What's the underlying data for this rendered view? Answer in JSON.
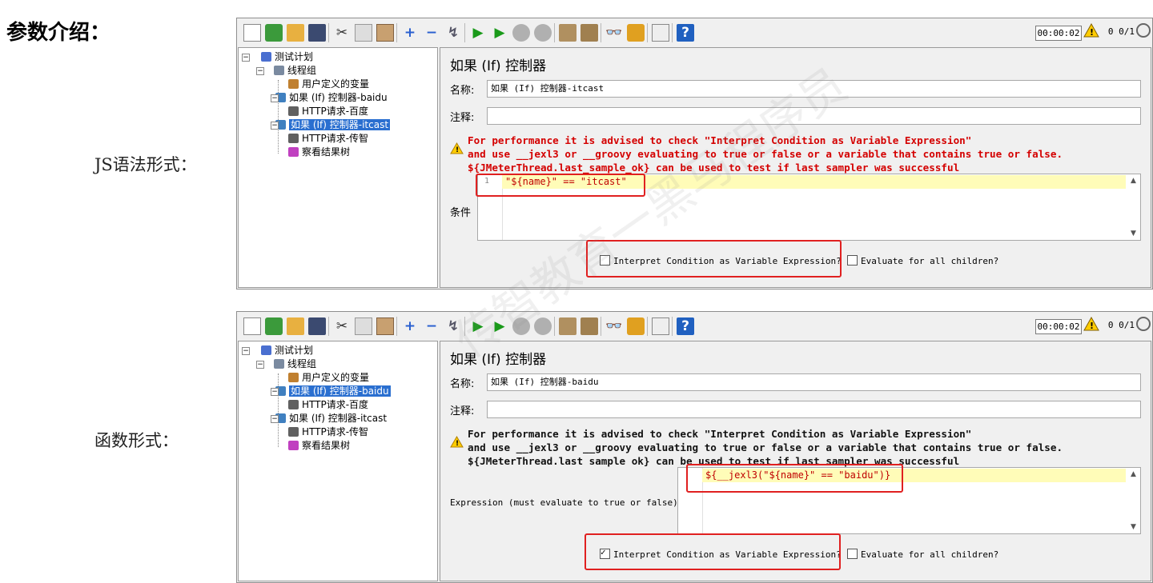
{
  "heading": "参数介绍：",
  "captions": [
    "JS语法形式：",
    "函数形式："
  ],
  "watermark": "传智教育一黑马程序员",
  "colors": {
    "selection": "#2a6fd0",
    "warning_text": "#d40000",
    "highlight_box": "#e02020",
    "code_line_bg": "#fffcb8"
  },
  "toolbar": {
    "icons": [
      "new-icon",
      "templates-icon",
      "open-icon",
      "save-icon",
      "cut-icon",
      "copy-icon",
      "paste-icon",
      "expand-icon",
      "collapse-icon",
      "toggle-icon",
      "start-icon",
      "start-no-pause-icon",
      "stop-icon",
      "shutdown-icon",
      "clear-icon",
      "clear-all-icon",
      "search-icon",
      "reset-search-icon",
      "function-helper-icon",
      "help-icon"
    ],
    "timer": "00:00:02",
    "warn_count": "0",
    "threads": "0/1"
  },
  "screens": [
    {
      "tree": [
        {
          "label": "测试计划",
          "icon": "test-plan-icon",
          "selected": false
        },
        {
          "label": "线程组",
          "icon": "thread-group-icon",
          "selected": false
        },
        {
          "label": "用户定义的变量",
          "icon": "variables-icon",
          "selected": false
        },
        {
          "label": "如果 (If) 控制器-baidu",
          "icon": "if-controller-icon",
          "selected": false
        },
        {
          "label": "HTTP请求-百度",
          "icon": "http-sampler-icon",
          "selected": false
        },
        {
          "label": "如果 (If) 控制器-itcast",
          "icon": "if-controller-icon",
          "selected": true
        },
        {
          "label": "HTTP请求-传智",
          "icon": "http-sampler-icon",
          "selected": false
        },
        {
          "label": "察看结果树",
          "icon": "listener-icon",
          "selected": false
        }
      ],
      "panel_title": "如果 (If) 控制器",
      "name_label": "名称:",
      "name_value": "如果 (If) 控制器-itcast",
      "comment_label": "注释:",
      "comment_value": "",
      "notice": [
        "For performance it is advised to check \"Interpret Condition as Variable Expression\"",
        "and use __jexl3 or __groovy evaluating to true or false or a variable that contains true or false.",
        "${JMeterThread.last_sample_ok} can be used to test if last sampler was successful"
      ],
      "editor_label": "条件",
      "line_number": "1",
      "code": "\"${name}\" == \"itcast\"",
      "interpret_label": "Interpret Condition as Variable Expression?",
      "interpret_checked": false,
      "evaluate_label": "Evaluate for all children?",
      "evaluate_checked": false
    },
    {
      "tree": [
        {
          "label": "测试计划",
          "icon": "test-plan-icon",
          "selected": false
        },
        {
          "label": "线程组",
          "icon": "thread-group-icon",
          "selected": false
        },
        {
          "label": "用户定义的变量",
          "icon": "variables-icon",
          "selected": false
        },
        {
          "label": "如果 (If) 控制器-baidu",
          "icon": "if-controller-icon",
          "selected": true
        },
        {
          "label": "HTTP请求-百度",
          "icon": "http-sampler-icon",
          "selected": false
        },
        {
          "label": "如果 (If) 控制器-itcast",
          "icon": "if-controller-icon",
          "selected": false
        },
        {
          "label": "HTTP请求-传智",
          "icon": "http-sampler-icon",
          "selected": false
        },
        {
          "label": "察看结果树",
          "icon": "listener-icon",
          "selected": false
        }
      ],
      "panel_title": "如果 (If) 控制器",
      "name_label": "名称:",
      "name_value": "如果 (If) 控制器-baidu",
      "comment_label": "注释:",
      "comment_value": "",
      "notice": [
        "For performance it is advised to check \"Interpret Condition as Variable Expression\"",
        "and use __jexl3 or __groovy evaluating to true or false or a variable that contains true or false.",
        "${JMeterThread.last sample ok} can be used to test if last sampler was successful"
      ],
      "editor_label": "Expression (must evaluate to true or false)",
      "line_number": "",
      "code": "${__jexl3(\"${name}\" == \"baidu\")}",
      "interpret_label": "Interpret Condition as Variable Expression?",
      "interpret_checked": true,
      "evaluate_label": "Evaluate for all children?",
      "evaluate_checked": false
    }
  ]
}
